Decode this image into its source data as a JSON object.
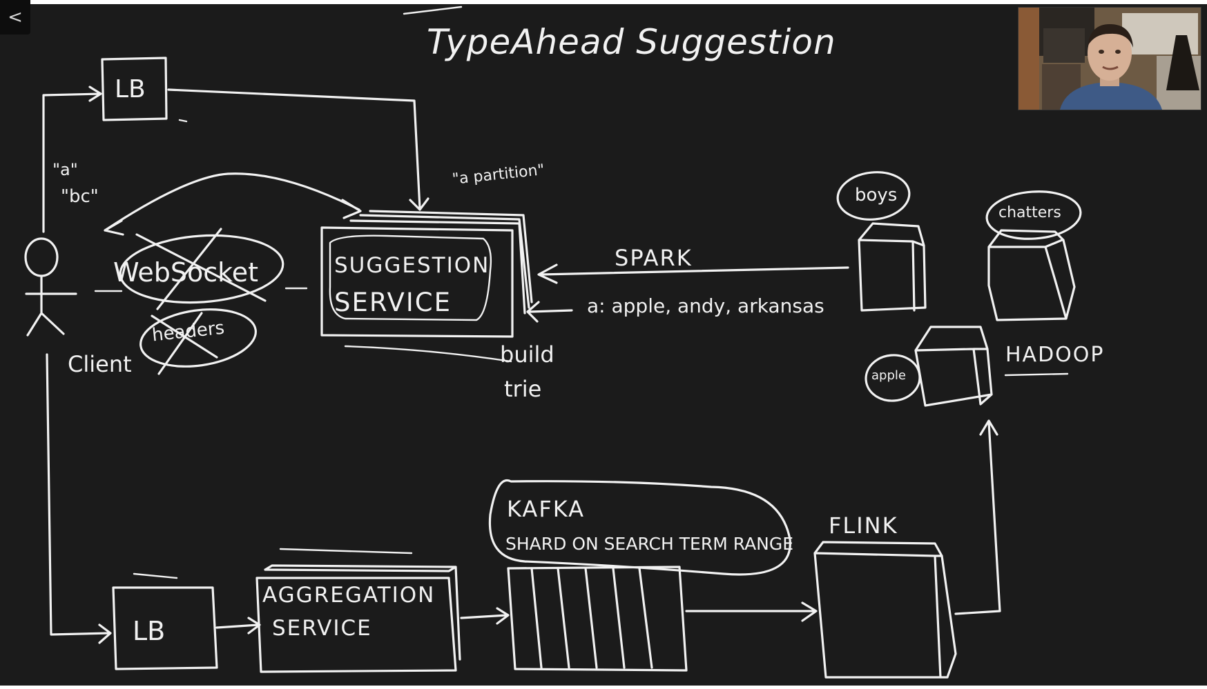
{
  "title": "TypeAhead Suggestion",
  "navigation": {
    "back_glyph": "<",
    "back_icon": "chevron-left-icon"
  },
  "diagram": {
    "load_balancer_top": "LB",
    "load_balancer_bottom": "LB",
    "client_label": "Client",
    "request_a": "\"a\"",
    "request_bc": "\"bc\"",
    "partition_note": "\"a partition\"",
    "websocket": "WebSocket",
    "crossed_out_word": "headers",
    "suggestion_service_line1": "SUGGESTION",
    "suggestion_service_line2": "SERVICE",
    "build_trie_line1": "build",
    "build_trie_line2": "trie",
    "spark": "SPARK",
    "spark_output": "a: apple, andy, arkansas",
    "node_boys": "boys",
    "node_chatters": "chatters",
    "node_apple": "apple",
    "hadoop": "HADOOP",
    "kafka": "KAFKA",
    "kafka_note": "SHARD ON SEARCH TERM RANGE",
    "flink": "FLINK",
    "aggregation_service_line1": "AGGREGATION",
    "aggregation_service_line2": "SERVICE"
  },
  "colors": {
    "board": "#1b1b1b",
    "ink": "#f2f2f2"
  }
}
